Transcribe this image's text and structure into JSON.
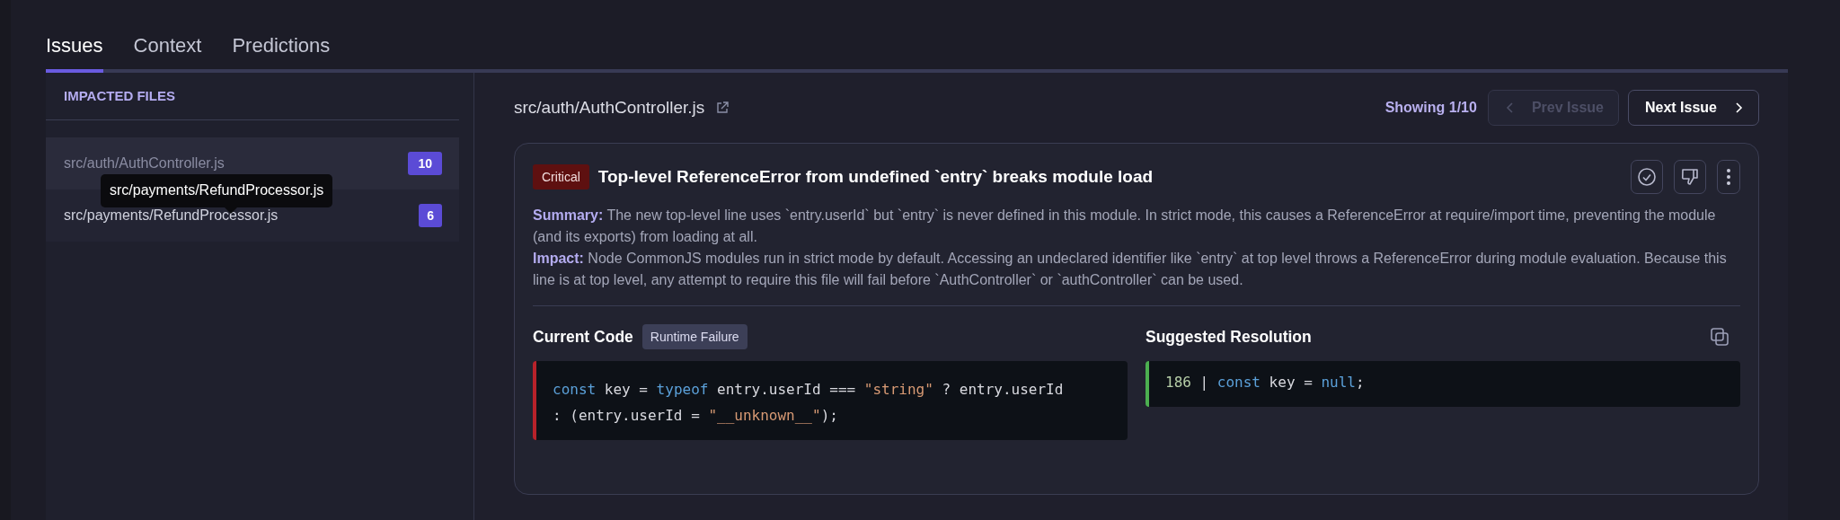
{
  "tabs": [
    {
      "label": "Issues",
      "selected": true
    },
    {
      "label": "Context",
      "selected": false
    },
    {
      "label": "Predictions",
      "selected": false
    }
  ],
  "sidebar": {
    "heading": "IMPACTED FILES",
    "items": [
      {
        "path": "src/auth/AuthController.js",
        "count": "10",
        "selected": true
      },
      {
        "path": "src/payments/RefundProcessor.js",
        "count": "6",
        "selected": false
      }
    ],
    "tooltip": "src/payments/RefundProcessor.js"
  },
  "file_path": "src/auth/AuthController.js",
  "pager": {
    "showing": "Showing 1/10",
    "prev": {
      "label": "Prev Issue",
      "disabled": true
    },
    "next": {
      "label": "Next Issue",
      "disabled": false
    }
  },
  "issue": {
    "severity": "Critical",
    "title": "Top-level ReferenceError from undefined `entry` breaks module load",
    "details": [
      {
        "label": "Summary:",
        "text": "The new top-level line uses `entry.userId` but `entry` is never defined in this module. In strict mode, this causes a ReferenceError at require/import time, preventing the module (and its exports) from loading at all."
      },
      {
        "label": "Impact:",
        "text": "Node CommonJS modules run in strict mode by default. Accessing an undeclared identifier like `entry` at top level throws a ReferenceError during module evaluation. Because this line is at top level, any attempt to require this file will fail before `AuthController` or `authController` can be used."
      }
    ],
    "current": {
      "heading": "Current Code",
      "tag": "Runtime Failure",
      "lines": [
        [
          {
            "kind": "keyword",
            "text": "const"
          },
          {
            "kind": "plain",
            "text": " key = "
          },
          {
            "kind": "keyword",
            "text": "typeof"
          },
          {
            "kind": "plain",
            "text": " entry.userId === "
          },
          {
            "kind": "string",
            "text": "\"string\""
          },
          {
            "kind": "plain",
            "text": " ? entry.userId"
          }
        ],
        [
          {
            "kind": "plain",
            "text": ": (entry.userId = "
          },
          {
            "kind": "string",
            "text": "\"__unknown__\""
          },
          {
            "kind": "plain",
            "text": ");"
          }
        ]
      ]
    },
    "suggested": {
      "heading": "Suggested Resolution",
      "lines": [
        [
          {
            "kind": "number",
            "text": "186"
          },
          {
            "kind": "plain",
            "text": " | "
          },
          {
            "kind": "keyword",
            "text": "const"
          },
          {
            "kind": "plain",
            "text": " key = "
          },
          {
            "kind": "keyword",
            "text": "null"
          },
          {
            "kind": "plain",
            "text": ";"
          }
        ]
      ]
    }
  }
}
